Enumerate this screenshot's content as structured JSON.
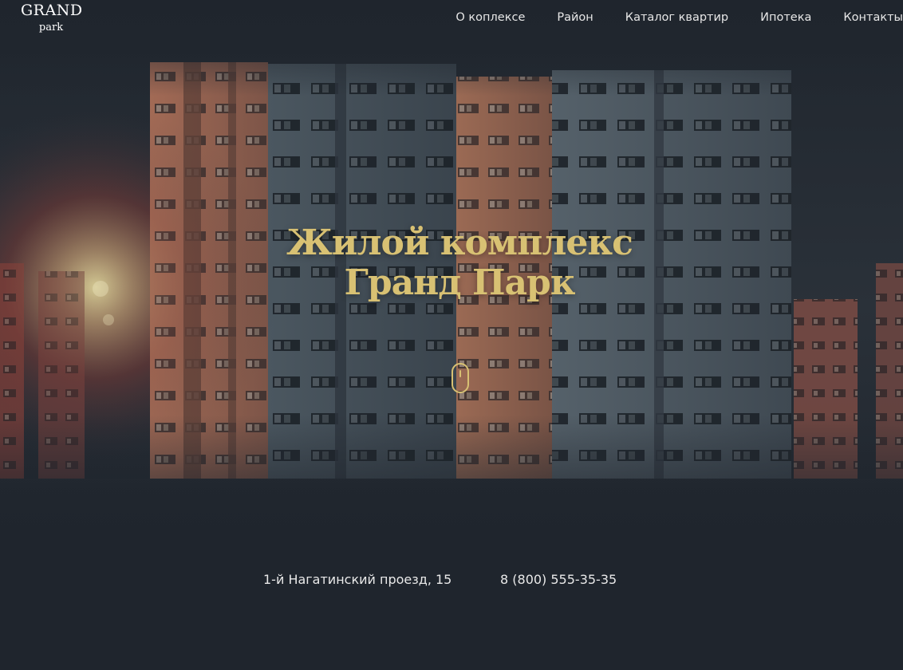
{
  "header": {
    "logo_top": "GRAND",
    "logo_bottom": "park",
    "nav": [
      {
        "label": "О коплексе"
      },
      {
        "label": "Район"
      },
      {
        "label": "Каталог квартир"
      },
      {
        "label": "Ипотека"
      },
      {
        "label": "Контакты"
      }
    ]
  },
  "hero": {
    "title_line1": "Жилой комплекс",
    "title_line2": "Гранд Парк",
    "scroll_icon": "mouse-scroll-icon",
    "background_image": "apartment-buildings-photo"
  },
  "contacts": {
    "address": "1-й Нагатинский проезд, 15",
    "phone": "8 (800) 555-35-35"
  },
  "colors": {
    "background": "#1f252d",
    "accent": "#d8c173",
    "text": "#e9e9e9"
  }
}
